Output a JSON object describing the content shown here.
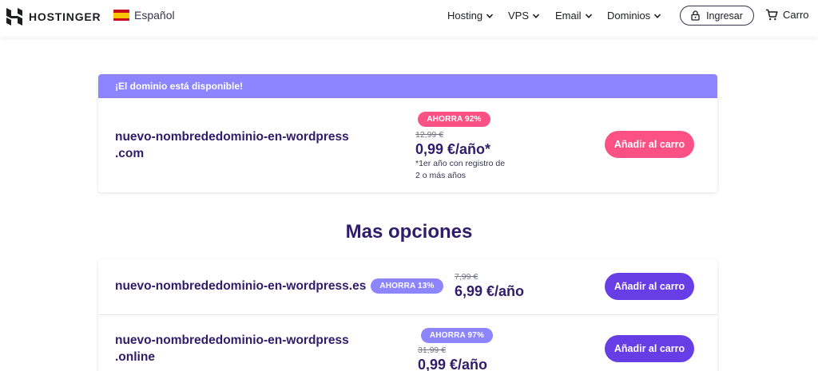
{
  "header": {
    "logo_text": "HOSTINGER",
    "language": "Español",
    "nav": [
      "Hosting",
      "VPS",
      "Email",
      "Dominios"
    ],
    "login_label": "Ingresar",
    "cart_label": "Carro"
  },
  "available": {
    "banner": "¡El dominio está disponible!",
    "domain_line1": "nuevo-nombrededominio-en-wordpress",
    "domain_line2": ".com",
    "badge": "AHORRA 92%",
    "old_price": "12,99 €",
    "price": "0,99 €/año*",
    "note_line1": "*1er año con registro de",
    "note_line2": "2 o más años",
    "button": "Añadir al carro"
  },
  "more": {
    "title": "Mas opciones",
    "options": [
      {
        "domain": "nuevo-nombrededominio-en-wordpress.es",
        "badge": "AHORRA 13%",
        "old_price": "7,99 €",
        "price": "6,99 €/año",
        "button": "Añadir al carro"
      },
      {
        "domain_line1": "nuevo-nombrededominio-en-wordpress",
        "domain_line2": ".online",
        "badge": "AHORRA 97%",
        "old_price": "31,99 €",
        "price": "0,99 €/año",
        "button": "Añadir al carro"
      }
    ]
  },
  "colors": {
    "accent_purple": "#673de6",
    "light_purple": "#8c85ff",
    "pink": "#fc5185",
    "text_dark": "#2f1c6a"
  }
}
